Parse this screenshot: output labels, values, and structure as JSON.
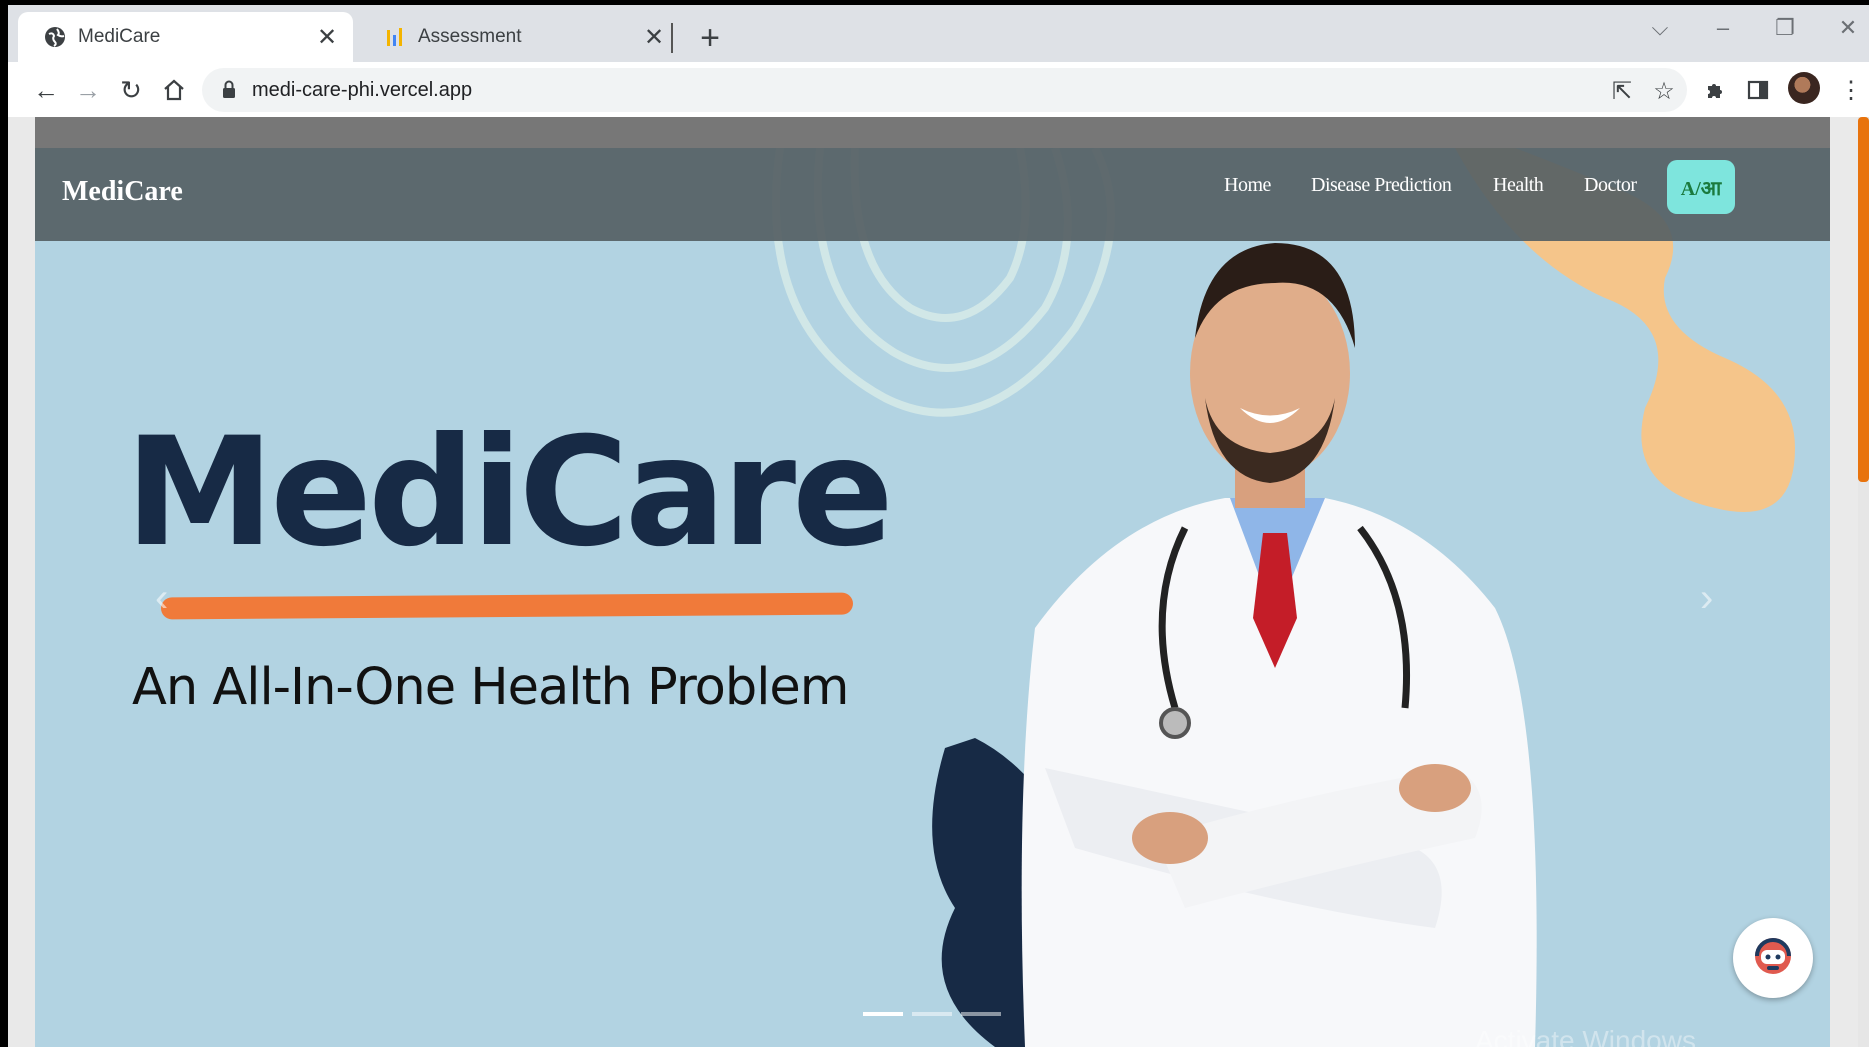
{
  "browser": {
    "tabs": [
      {
        "title": "MediCare",
        "active": true,
        "icon": "globe-icon"
      },
      {
        "title": "Assessment",
        "active": false,
        "icon": "bar-chart-icon"
      }
    ],
    "address": "medi-care-phi.vercel.app"
  },
  "site": {
    "brand": "MediCare",
    "nav": [
      "Home",
      "Disease Prediction",
      "Health",
      "Doctor"
    ],
    "language_toggle": "A/आ"
  },
  "hero": {
    "title": "MediCare",
    "subtitle": "An All-In-One Health Problem",
    "active_slide": 1,
    "slide_count": 3
  },
  "overlay": {
    "watermark": "Activate Windows"
  },
  "colors": {
    "hero_bg": "#b2d3e2",
    "title": "#172a45",
    "underline": "#f07a3a",
    "lang_button": "#7ee5dd",
    "scroll_thumb": "#e8730d"
  }
}
